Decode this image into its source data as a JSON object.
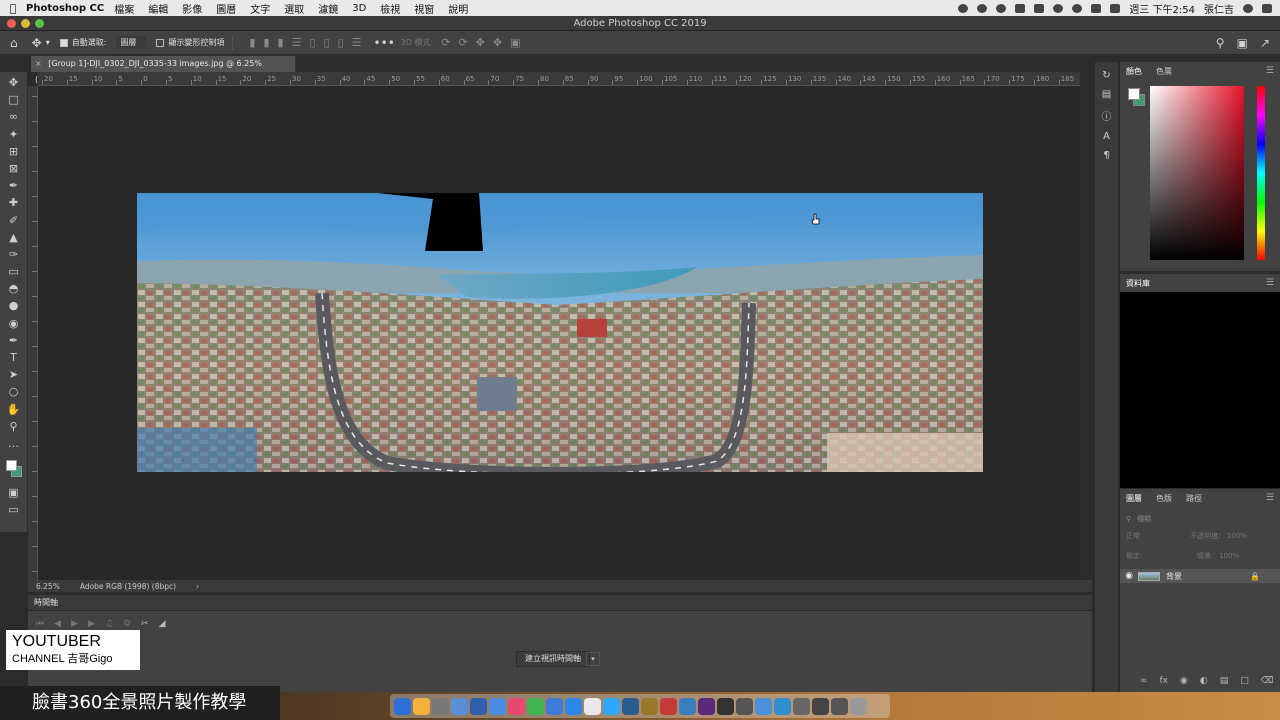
{
  "menubar": {
    "app_name": "Photoshop CC",
    "items": [
      "檔案",
      "編輯",
      "影像",
      "圖層",
      "文字",
      "選取",
      "濾鏡",
      "3D",
      "檢視",
      "視窗",
      "說明"
    ],
    "clock": "週三 下午2:54",
    "user": "張仁吉"
  },
  "window": {
    "title": "Adobe Photoshop CC 2019"
  },
  "options_bar": {
    "auto_select_label": "自動選取:",
    "auto_select_value": "圖層",
    "show_transform_label": "顯示變形控制項",
    "mode_3d_label": "3D 模式:"
  },
  "document": {
    "tab_title": "[Group 1]-DJI_0302_DJI_0335-33 images.jpg @ 6.25% (RGB/8*)",
    "zoom": "6.25%",
    "color_profile": "Adobe RGB (1998) (8bpc)"
  },
  "ruler_ticks": [
    "20",
    "15",
    "10",
    "5",
    "0",
    "5",
    "10",
    "15",
    "20",
    "25",
    "30",
    "35",
    "40",
    "45",
    "50",
    "55",
    "60",
    "65",
    "70",
    "75",
    "80",
    "85",
    "90",
    "95",
    "100",
    "105",
    "110",
    "115",
    "120",
    "125",
    "130",
    "135",
    "140",
    "145",
    "150",
    "155",
    "160",
    "165",
    "170",
    "175",
    "180",
    "185"
  ],
  "timeline": {
    "title": "時間軸",
    "create_button": "建立視訊時間軸"
  },
  "panels": {
    "color_tabs": [
      "顏色",
      "色票"
    ],
    "properties_tab": "資料庫",
    "layers_tabs": [
      "圖層",
      "色版",
      "路徑"
    ],
    "layer_kind": "種類",
    "blend_mode": "正常",
    "opacity_label": "不透明度:",
    "opacity_value": "100%",
    "lock_label": "鎖定:",
    "fill_label": "填滿:",
    "fill_value": "100%",
    "layer_name": "背景"
  },
  "watermark": {
    "line1": "YOUTUBER",
    "line2": "CHANNEL 吉哥Gigo"
  },
  "caption": "臉書360全景照片製作教學",
  "colors": {
    "foreground": "#ffffff",
    "background": "#3f9b73",
    "panel": "#424242",
    "canvas": "#282828"
  }
}
